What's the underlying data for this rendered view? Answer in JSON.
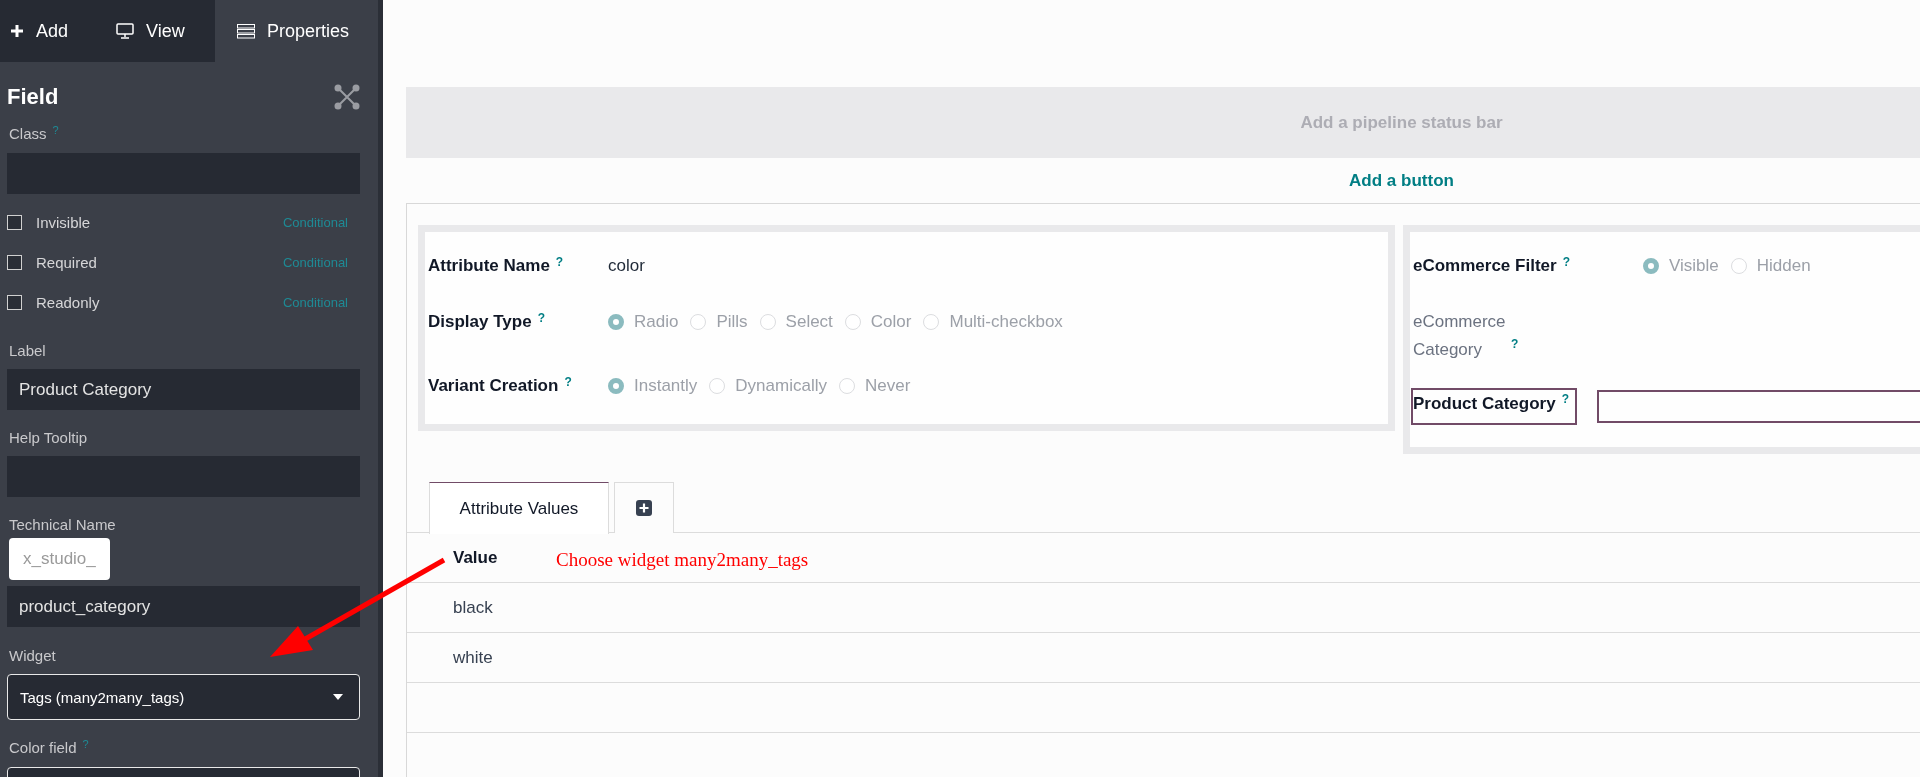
{
  "sidebar": {
    "tabs": [
      {
        "label": "Add",
        "selected": false
      },
      {
        "label": "View",
        "selected": false
      },
      {
        "label": "Properties",
        "selected": true
      }
    ],
    "title": "Field",
    "class_field": {
      "label": "Class",
      "help": "?"
    },
    "toggles": [
      {
        "label": "Invisible",
        "checked": false,
        "link": "Conditional"
      },
      {
        "label": "Required",
        "checked": false,
        "link": "Conditional"
      },
      {
        "label": "Readonly",
        "checked": false,
        "link": "Conditional"
      }
    ],
    "label_field": {
      "label": "Label",
      "value": "Product Category"
    },
    "help_field": {
      "label": "Help Tooltip"
    },
    "technical_name": {
      "label": "Technical Name",
      "prefix": "x_studio_",
      "value": "product_category"
    },
    "widget": {
      "label": "Widget",
      "value": "Tags (many2many_tags)"
    },
    "color_field": {
      "label": "Color field",
      "help": "?"
    }
  },
  "main": {
    "pipeline_placeholder": "Add a pipeline status bar",
    "add_button": "Add a button",
    "left_group": [
      {
        "kind": "text",
        "label": "Attribute Name",
        "help": "?",
        "value": "color"
      },
      {
        "kind": "radio",
        "label": "Display Type",
        "help": "?",
        "options": [
          {
            "label": "Radio",
            "selected": true
          },
          {
            "label": "Pills",
            "selected": false
          },
          {
            "label": "Select",
            "selected": false
          },
          {
            "label": "Color",
            "selected": false
          },
          {
            "label": "Multi-checkbox",
            "selected": false
          }
        ]
      },
      {
        "kind": "radio",
        "label": "Variant Creation",
        "help": "?",
        "options": [
          {
            "label": "Instantly",
            "selected": true
          },
          {
            "label": "Dynamically",
            "selected": false
          },
          {
            "label": "Never",
            "selected": false
          }
        ]
      }
    ],
    "right_group": [
      {
        "kind": "radio",
        "label": "eCommerce Filter",
        "help": "?",
        "options": [
          {
            "label": "Visible",
            "selected": true
          },
          {
            "label": "Hidden",
            "selected": false
          }
        ]
      },
      {
        "kind": "hidden",
        "label": "eCommerce Category",
        "help": "?"
      },
      {
        "kind": "new_field",
        "label": "Product Category",
        "help": "?"
      }
    ],
    "notebook": {
      "tabs": [
        {
          "kind": "text",
          "label": "Attribute Values",
          "selected": true
        },
        {
          "kind": "add",
          "selected": false
        }
      ]
    },
    "table": {
      "columns": [
        "Value"
      ],
      "rows": [
        [
          "black"
        ],
        [
          "white"
        ]
      ]
    }
  },
  "annotation": {
    "text": "Choose widget many2many_tags"
  }
}
